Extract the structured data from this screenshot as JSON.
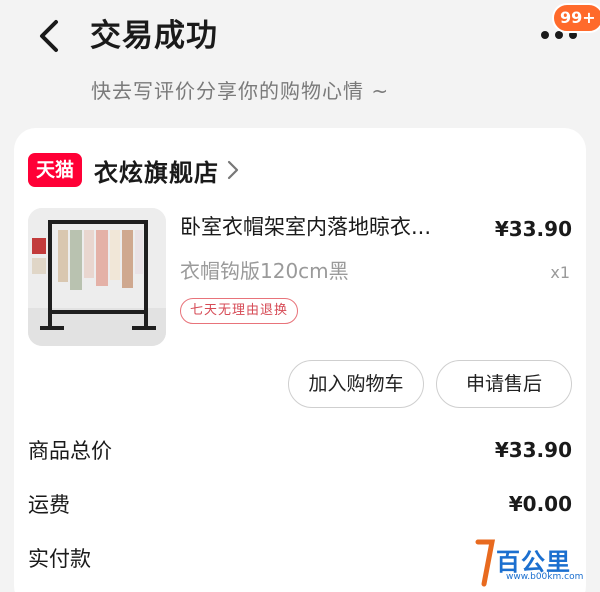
{
  "header": {
    "title": "交易成功",
    "subtitle": "快去写评价分享你的购物心情 ~",
    "badge": "99+"
  },
  "store": {
    "platform_badge": "天猫",
    "name": "衣炫旗舰店"
  },
  "product": {
    "title": "卧室衣帽架室内落地晾衣...",
    "price": "¥33.90",
    "sku": "衣帽钩版120cm黑",
    "quantity": "x1",
    "tag": "七天无理由退换"
  },
  "actions": {
    "add_to_cart": "加入购物车",
    "after_sale": "申请售后"
  },
  "summary": {
    "total_label": "商品总价",
    "total_value": "¥33.90",
    "shipping_label": "运费",
    "shipping_value": "¥0.00",
    "paid_label": "实付款"
  },
  "watermark": {
    "text": "百公里",
    "url": "www.b00km.com"
  },
  "colors": {
    "tmall_red": "#ff0036",
    "badge_orange": "#ff6a2b",
    "tag_red": "#d64a55",
    "watermark_blue": "#1b6fcf"
  },
  "icons": {
    "back": "chevron-left-icon",
    "more": "more-dots-icon",
    "store_chevron": "chevron-right-icon"
  }
}
